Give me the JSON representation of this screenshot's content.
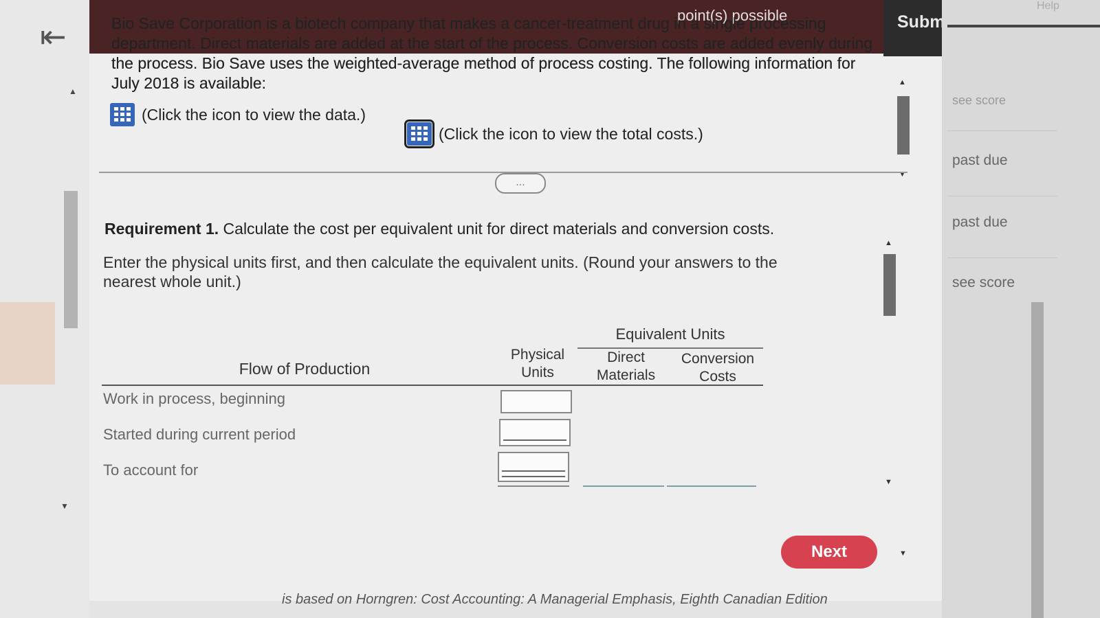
{
  "header": {
    "points_label": "point(s) possible",
    "submit_label": "Submit quiz"
  },
  "problem": {
    "text": "Bio Save Corporation is a biotech company that makes a cancer-treatment drug in a single processing department. Direct materials are added at the start of the process. Conversion costs are added evenly during the process. Bio Save uses the weighted-average method of process costing. The following information for July 2018 is available:",
    "data_link": "(Click the icon to view the data.)",
    "total_costs_link": "(Click the icon to view the total costs.)"
  },
  "drag_handle": "...",
  "requirement": {
    "label": "Requirement 1.",
    "text": "Calculate the cost per equivalent unit for direct materials and conversion costs.",
    "instruction": "Enter the physical units first, and then calculate the equivalent units. (Round your answers to the nearest whole unit.)"
  },
  "table": {
    "equivalent_units_header": "Equivalent Units",
    "flow_header": "Flow of Production",
    "physical_units_header": [
      "Physical",
      "Units"
    ],
    "direct_materials_header": [
      "Direct",
      "Materials"
    ],
    "conversion_costs_header": [
      "Conversion",
      "Costs"
    ],
    "rows": [
      {
        "label": "Work in process, beginning",
        "physical_units": ""
      },
      {
        "label": "Started during current period",
        "physical_units": ""
      },
      {
        "label": "To account for",
        "physical_units": ""
      }
    ]
  },
  "next_label": "Next",
  "footer_text": "is based on Horngren: Cost Accounting: A Managerial Emphasis, Eighth Canadian Edition",
  "sidebar": {
    "help": "Help",
    "statuses": [
      "see score",
      "past due",
      "past due",
      "see score"
    ]
  },
  "colors": {
    "topbar": "#4a2424",
    "next_button": "#d6424f",
    "grid_icon": "#3566b8"
  }
}
